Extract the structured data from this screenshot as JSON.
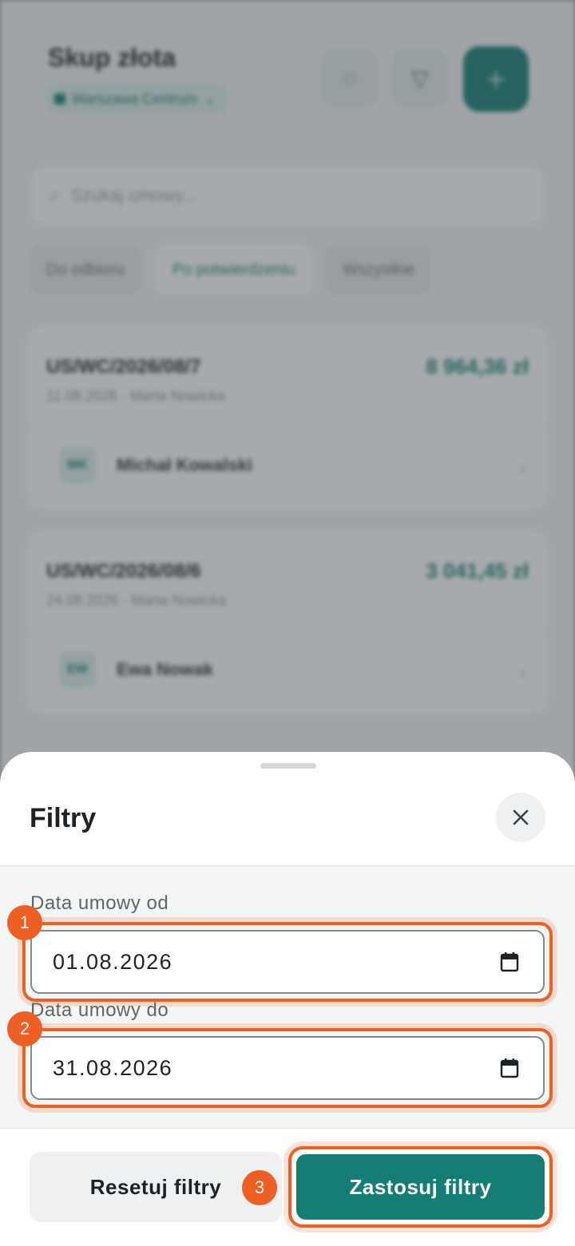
{
  "background": {
    "title": "Skup złota",
    "company": "Warszawa Centrum",
    "search_placeholder": "Szukaj umowy...",
    "chips": [
      "Do odbioru",
      "Po potwierdzeniu",
      "Wszystkie"
    ],
    "cards": [
      {
        "number": "US/WC/2026/08/7",
        "meta": "11.08.2026 · Marta Nowicka",
        "amount": "8 964,36 zł",
        "client_initials": "MK",
        "client_name": "Michał Kowalski"
      },
      {
        "number": "US/WC/2026/08/6",
        "meta": "24.08.2026 · Marta Nowicka",
        "amount": "3 041,45 zł",
        "client_initials": "EW",
        "client_name": "Ewa Nowak"
      }
    ]
  },
  "sheet": {
    "title": "Filtry",
    "fields": [
      {
        "label": "Data umowy od",
        "value": "01.08.2026",
        "badge": "1"
      },
      {
        "label": "Data umowy do",
        "value": "31.08.2026",
        "badge": "2"
      }
    ],
    "reset_label": "Resetuj filtry",
    "apply_label": "Zastosuj filtry",
    "apply_badge": "3"
  },
  "colors": {
    "accent": "#147d74",
    "highlight": "#ef5f24"
  }
}
